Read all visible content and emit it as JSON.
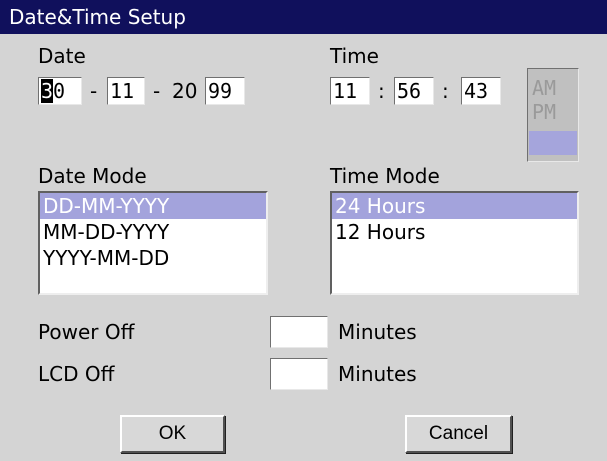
{
  "window": {
    "title": "Date&Time Setup"
  },
  "date": {
    "label": "Date",
    "day": "30",
    "day_cursor": "3",
    "day_rest": "0",
    "month": "11",
    "year_prefix": "20",
    "year_suffix": "99",
    "sep1": "-",
    "sep2": "-"
  },
  "time": {
    "label": "Time",
    "hour": "11",
    "minute": "56",
    "second": "43",
    "sep1": ":",
    "sep2": ":",
    "am_label": "AM",
    "pm_label": "PM"
  },
  "date_mode": {
    "label": "Date Mode",
    "options": [
      "DD-MM-YYYY",
      "MM-DD-YYYY",
      "YYYY-MM-DD"
    ],
    "selected": "DD-MM-YYYY"
  },
  "time_mode": {
    "label": "Time Mode",
    "options": [
      "24 Hours",
      "12 Hours"
    ],
    "selected": "24 Hours"
  },
  "power_off": {
    "label": "Power Off",
    "value": "",
    "unit": "Minutes"
  },
  "lcd_off": {
    "label": "LCD Off",
    "value": "",
    "unit": "Minutes"
  },
  "buttons": {
    "ok": "OK",
    "cancel": "Cancel"
  },
  "colors": {
    "title_bar": "#10105c",
    "background": "#d4d4d4",
    "selection": "#a3a3dc"
  }
}
